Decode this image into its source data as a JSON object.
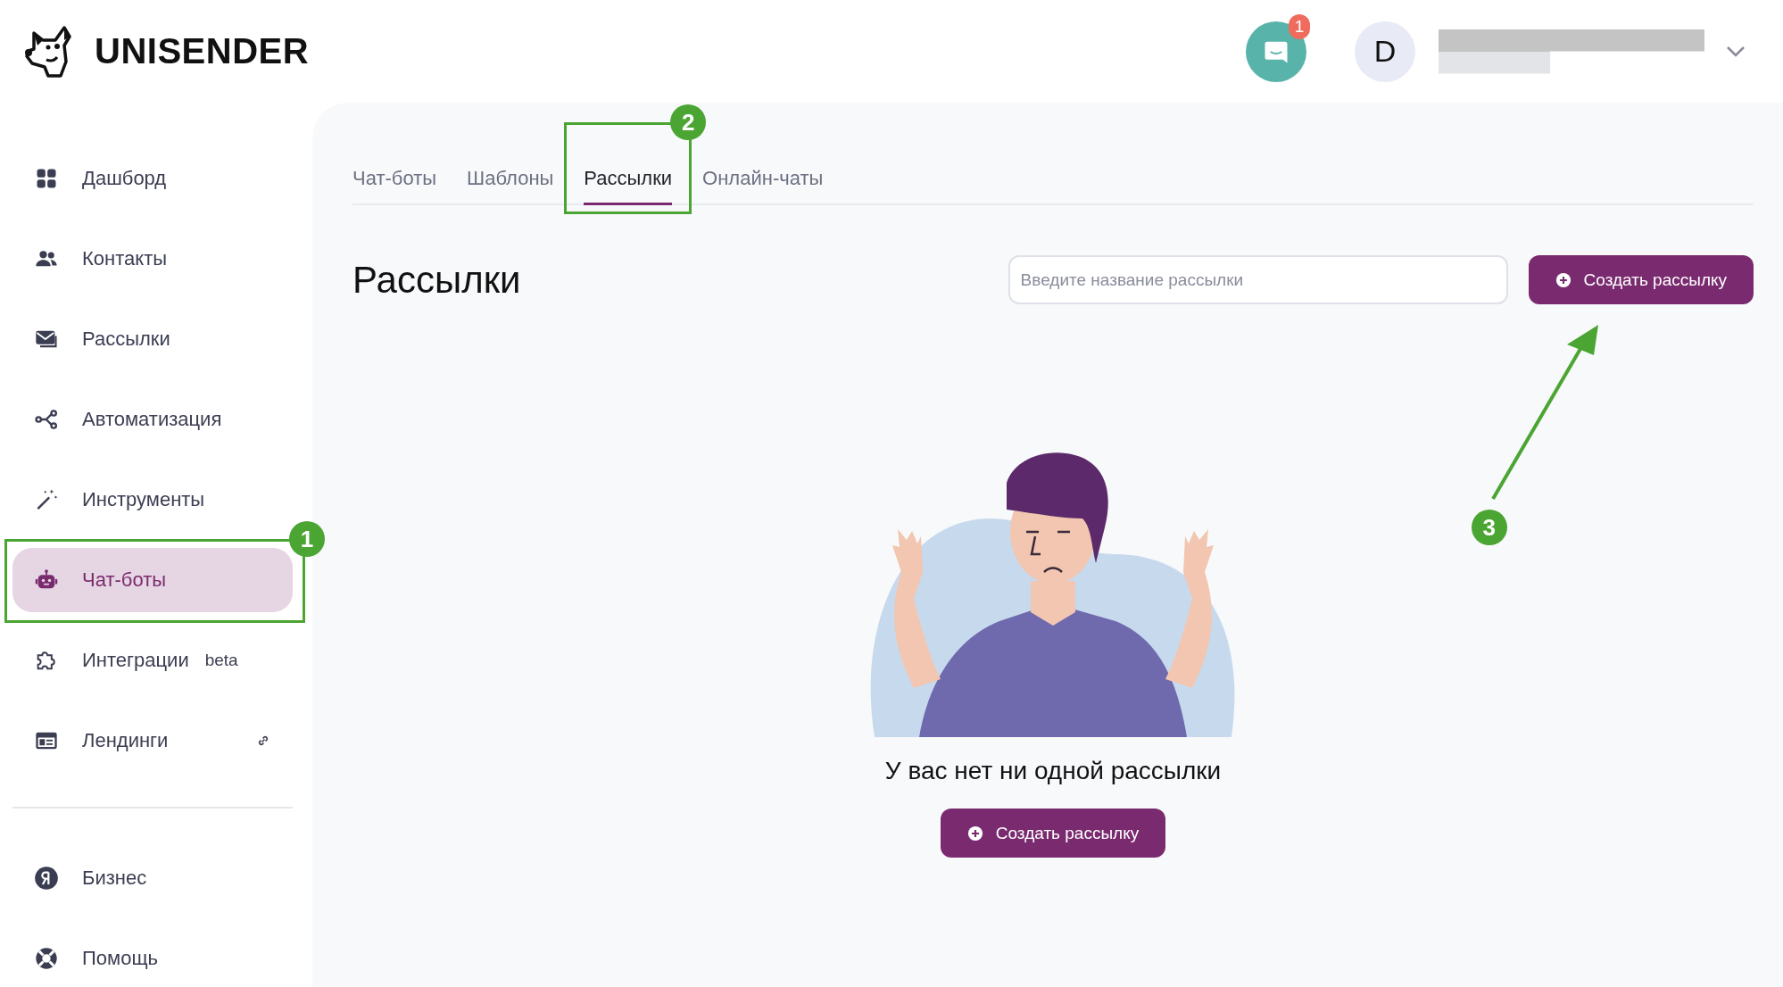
{
  "header": {
    "logo_text": "UNISENDER",
    "chat_badge": "1",
    "avatar_initial": "D"
  },
  "sidebar": {
    "items": [
      {
        "label": "Дашборд",
        "selected": false
      },
      {
        "label": "Контакты",
        "selected": false
      },
      {
        "label": "Рассылки",
        "selected": false
      },
      {
        "label": "Автоматизация",
        "selected": false
      },
      {
        "label": "Инструменты",
        "selected": false
      },
      {
        "label": "Чат-боты",
        "selected": true,
        "annotation": "1"
      },
      {
        "label": "Интеграции",
        "selected": false,
        "tag": "beta"
      },
      {
        "label": "Лендинги",
        "selected": false,
        "linked": true
      }
    ],
    "bottom_items": [
      {
        "label": "Бизнес",
        "selected": false
      },
      {
        "label": "Помощь",
        "selected": false
      }
    ]
  },
  "tabs": [
    {
      "label": "Чат-боты",
      "selected": false
    },
    {
      "label": "Шаблоны",
      "selected": false
    },
    {
      "label": "Рассылки",
      "selected": true,
      "annotation": "2"
    },
    {
      "label": "Онлайн-чаты",
      "selected": false
    }
  ],
  "page": {
    "title": "Рассылки",
    "search": {
      "placeholder": "Введите название рассылки"
    },
    "create_button": {
      "label": "Создать рассылку",
      "annotation": "3"
    }
  },
  "empty_state": {
    "message": "У вас нет ни одной рассылки",
    "button": "Создать рассылку"
  }
}
